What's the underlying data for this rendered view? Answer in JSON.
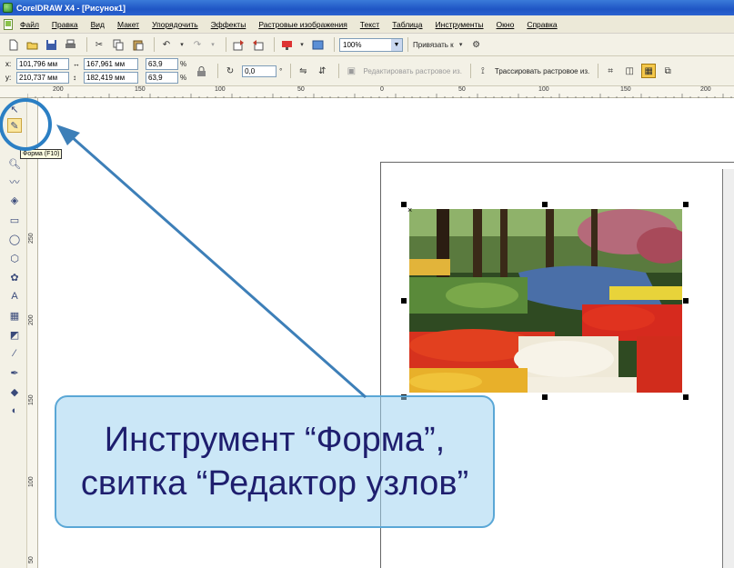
{
  "window": {
    "title": "CorelDRAW X4 - [Рисунок1]"
  },
  "menu": [
    "Файл",
    "Правка",
    "Вид",
    "Макет",
    "Упорядочить",
    "Эффекты",
    "Растровые изображения",
    "Текст",
    "Таблица",
    "Инструменты",
    "Окно",
    "Справка"
  ],
  "toolbar1": {
    "zoom_value": "100%",
    "snap_label": "Привязать к"
  },
  "toolbar2": {
    "x_label": "x:",
    "x_value": "101,796 мм",
    "y_label": "y:",
    "y_value": "210,737 мм",
    "w_value": "167,961 мм",
    "h_value": "182,419 мм",
    "scale_x": "63,9",
    "scale_y": "63,9",
    "percent": "%",
    "rotation": "0,0",
    "degree": "°",
    "edit_bitmap": "Редактировать растровое из.",
    "trace_bitmap": "Трассировать растровое из."
  },
  "ruler_h_labels": [
    "200",
    "150",
    "100",
    "50",
    "0",
    "50",
    "100",
    "150",
    "200"
  ],
  "ruler_v_labels": [
    "250",
    "200",
    "150",
    "100",
    "50"
  ],
  "toolbox": {
    "tooltip": "Форма (F10)",
    "tools": [
      "pick-tool-icon",
      "shape-tool-icon",
      "crop-tool-icon",
      "zoom-tool-icon",
      "freehand-tool-icon",
      "smart-fill-tool-icon",
      "rectangle-tool-icon",
      "ellipse-tool-icon",
      "polygon-tool-icon",
      "basic-shapes-icon",
      "text-tool-icon",
      "table-tool-icon",
      "interactive-tool-icon",
      "eyedropper-tool-icon",
      "outline-tool-icon",
      "fill-tool-icon",
      "interactive-fill-icon"
    ]
  },
  "callout": {
    "line1": "Инструмент “Форма”,",
    "line2": "свитка “Редактор узлов”"
  },
  "canvas": {
    "center_mark": "×"
  },
  "colors": {
    "arrow": "#3d7fb8",
    "highlight_circle": "#2b7fc4",
    "callout_fill": "#a0d4f0",
    "callout_text": "#1e1e6e"
  }
}
